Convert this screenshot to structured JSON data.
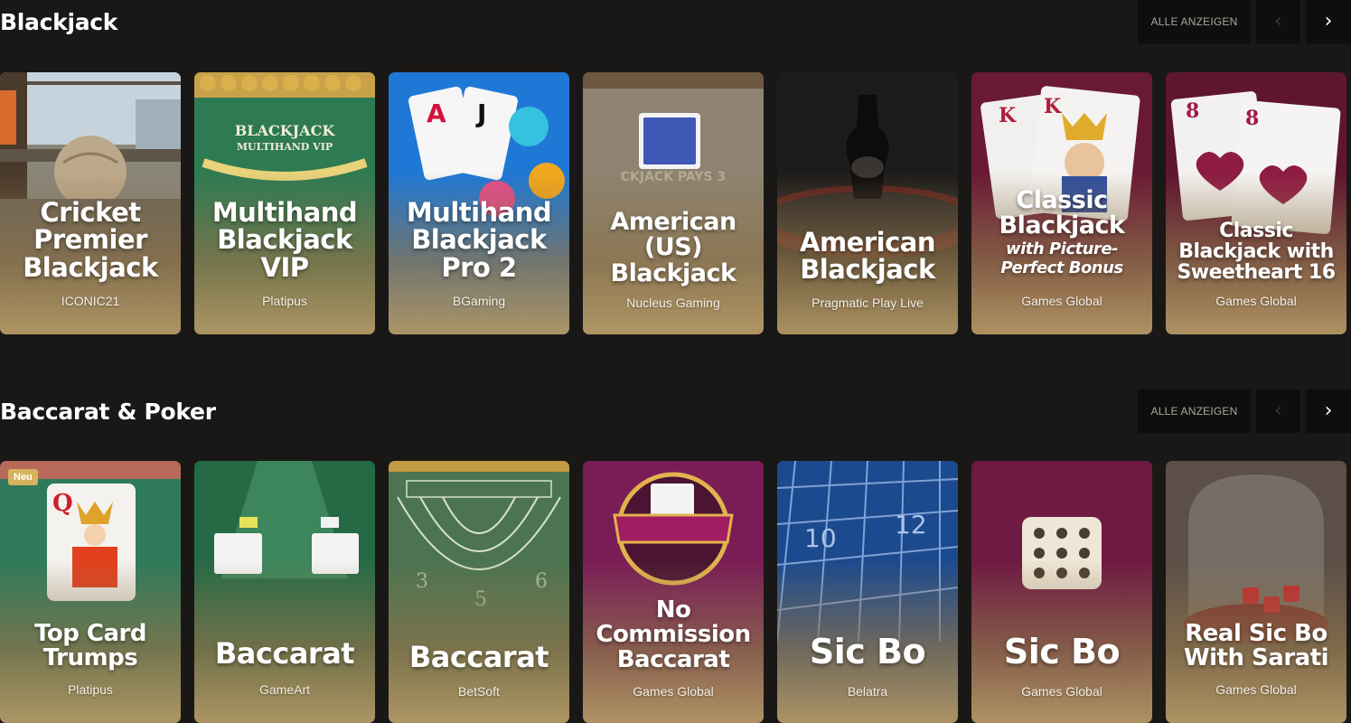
{
  "sections": [
    {
      "title": "Blackjack",
      "show_all": "ALLE ANZEIGEN",
      "prev_icon": "‹",
      "next_icon": "›",
      "cards": [
        {
          "title": "Cricket Premier Blackjack",
          "provider": "ICONIC21"
        },
        {
          "title": "Multihand Blackjack VIP",
          "provider": "Platipus"
        },
        {
          "title": "Multihand Blackjack Pro 2",
          "provider": "BGaming"
        },
        {
          "title": "American (US) Blackjack",
          "provider": "Nucleus Gaming"
        },
        {
          "title": "American Blackjack",
          "provider": "Pragmatic Play Live"
        },
        {
          "title": "Classic Blackjack",
          "title_sub": "with Picture-Perfect Bonus",
          "provider": "Games Global"
        },
        {
          "title": "Classic Blackjack with Sweetheart 16",
          "provider": "Games Global"
        }
      ]
    },
    {
      "title": "Baccarat & Poker",
      "show_all": "ALLE ANZEIGEN",
      "prev_icon": "‹",
      "next_icon": "›",
      "cards": [
        {
          "title": "Top Card Trumps",
          "provider": "Platipus",
          "badge": "Neu"
        },
        {
          "title": "Baccarat",
          "provider": "GameArt"
        },
        {
          "title": "Baccarat",
          "provider": "BetSoft"
        },
        {
          "title": "No Commission Baccarat",
          "provider": "Games Global"
        },
        {
          "title": "Sic Bo",
          "provider": "Belatra"
        },
        {
          "title": "Sic Bo",
          "provider": "Games Global"
        },
        {
          "title": "Real Sic Bo With Sarati",
          "provider": "Games Global"
        }
      ]
    }
  ],
  "colors": {
    "background": "#1a1816",
    "control_bg": "#0f0e0d",
    "badge": "#d8b25c"
  }
}
